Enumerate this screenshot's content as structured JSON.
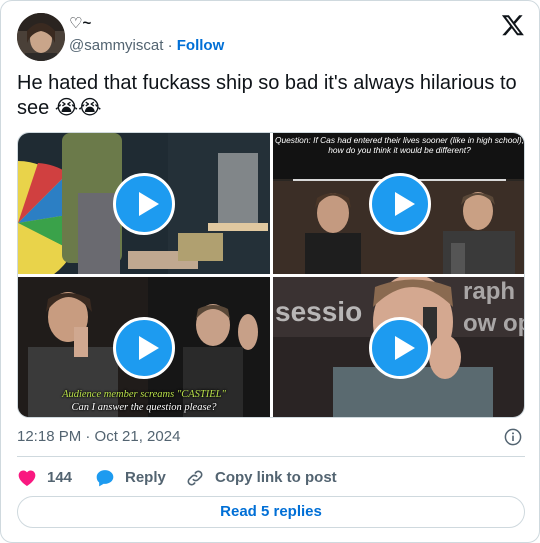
{
  "author": {
    "display_name": "♡~",
    "handle": "@sammyiscat",
    "separator": "·",
    "follow_label": "Follow"
  },
  "tweet": {
    "text": "He hated that fuckass ship so bad it's always hilarious to see 😭😭"
  },
  "media": {
    "tiles": [
      {
        "kind": "video"
      },
      {
        "kind": "video",
        "caption": "Question: If Cas had entered their lives sooner (like in high school), how do you think it would be different?"
      },
      {
        "kind": "video",
        "caption_line1": "Audience member screams \"CASTIEL\"",
        "caption_line2": "Can I answer the question please?"
      },
      {
        "kind": "video",
        "background_text_1": "sessio",
        "background_text_2": "raph",
        "background_text_3": "ow op"
      }
    ]
  },
  "meta": {
    "timestamp": "12:18 PM · Oct 21, 2024"
  },
  "actions": {
    "like_count": "144",
    "reply_label": "Reply",
    "copy_label": "Copy link to post"
  },
  "read_replies_label": "Read 5 replies",
  "colors": {
    "accent": "#1d9bf0",
    "link": "#006fd6",
    "like": "#f91880",
    "muted": "#536471"
  }
}
